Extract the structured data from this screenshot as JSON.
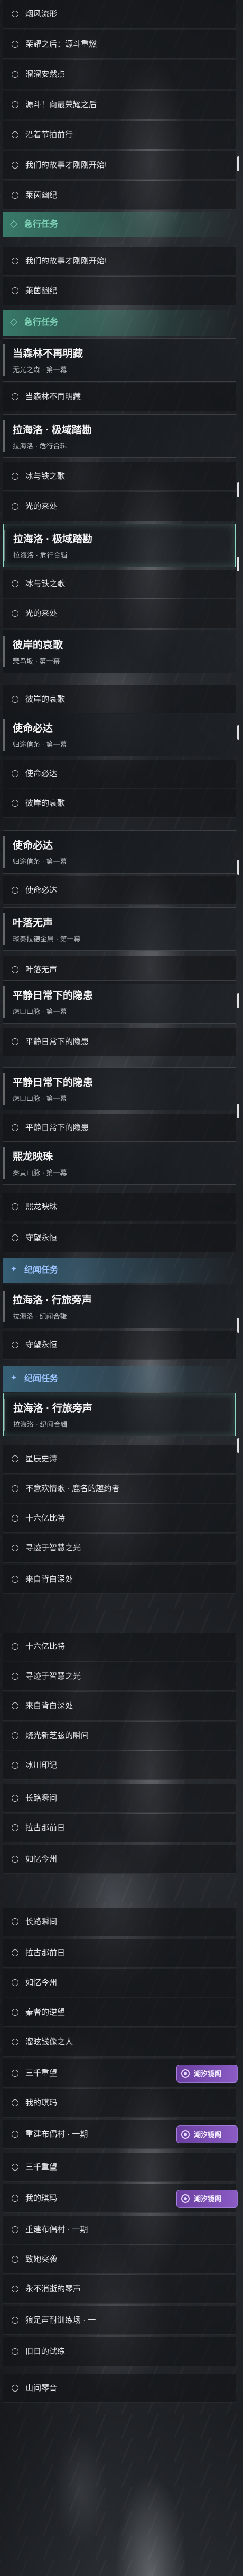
{
  "theme": {
    "rush_accent": "#7fd3b6",
    "rush_header_bg": "#3f8f7b",
    "tale_accent": "#9cc4ff",
    "tale_header_bg": "#3d6f8a",
    "badge_color": "#6b3fa0",
    "selected_border": "#8fd9c4"
  },
  "quest_log": {
    "rows": [
      {
        "kind": "item",
        "label": "烟风流形"
      },
      {
        "kind": "item",
        "label": "荣耀之后：源斗重燃"
      },
      {
        "kind": "item",
        "label": "溜溜安然点"
      },
      {
        "kind": "item",
        "label": "源斗！向最荣耀之后"
      },
      {
        "kind": "item",
        "label": "沿着节拍前行"
      },
      {
        "kind": "item",
        "label": "我们的故事才刚刚开始!"
      },
      {
        "kind": "item",
        "label": "莱茵幽纪"
      },
      {
        "kind": "header",
        "label": "急行任务",
        "icon": "diamond-icon",
        "style": "rush"
      },
      {
        "kind": "item",
        "label": "我们的故事才刚刚开始!"
      },
      {
        "kind": "item",
        "label": "莱茵幽纪"
      },
      {
        "kind": "header",
        "label": "急行任务",
        "icon": "diamond-icon",
        "style": "rush"
      },
      {
        "kind": "card",
        "title": "当森林不再明藏",
        "subtitle": "无光之森 · 第一幕"
      },
      {
        "kind": "item",
        "label": "当森林不再明藏"
      },
      {
        "kind": "card",
        "title": "拉海洛 · 极域踏勘",
        "subtitle": "拉海洛 · 危行合辑"
      },
      {
        "kind": "item",
        "label": "冰与铁之歌"
      },
      {
        "kind": "item",
        "label": "光的来处"
      },
      {
        "kind": "card",
        "title": "拉海洛 · 极域踏勘",
        "subtitle": "拉海洛 · 危行合辑",
        "selected": true
      },
      {
        "kind": "item",
        "label": "冰与铁之歌"
      },
      {
        "kind": "item",
        "label": "光的来处"
      },
      {
        "kind": "card",
        "title": "彼岸的哀歌",
        "subtitle": "悲鸟坂 · 第一幕"
      },
      {
        "kind": "item",
        "label": "彼岸的哀歌"
      },
      {
        "kind": "card",
        "title": "使命必达",
        "subtitle": "归途信条 · 第一幕"
      },
      {
        "kind": "item",
        "label": "使命必达"
      },
      {
        "kind": "item",
        "label": "彼岸的哀歌"
      },
      {
        "kind": "card",
        "title": "使命必达",
        "subtitle": "归途信条 · 第一幕"
      },
      {
        "kind": "item",
        "label": "使命必达"
      },
      {
        "kind": "card",
        "title": "叶落无声",
        "subtitle": "璨奏拉德金属 · 第一幕"
      },
      {
        "kind": "item",
        "label": "叶落无声"
      },
      {
        "kind": "card",
        "title": "平静日常下的隐患",
        "subtitle": "虎口山脉 · 第一幕"
      },
      {
        "kind": "item",
        "label": "平静日常下的隐患"
      },
      {
        "kind": "card",
        "title": "平静日常下的隐患",
        "subtitle": "虎口山脉 · 第一幕"
      },
      {
        "kind": "item",
        "label": "平静日常下的隐患"
      },
      {
        "kind": "card",
        "title": "熙龙映珠",
        "subtitle": "秦黄山脉 · 第一幕"
      },
      {
        "kind": "item",
        "label": "熙龙映珠"
      },
      {
        "kind": "item",
        "label": "守望永恒"
      },
      {
        "kind": "header",
        "label": "纪闻任务",
        "icon": "sparkle-icon",
        "style": "tale"
      },
      {
        "kind": "card",
        "title": "拉海洛 · 行旅旁声",
        "subtitle": "拉海洛 · 纪闻合辑"
      },
      {
        "kind": "item",
        "label": "守望永恒"
      },
      {
        "kind": "header",
        "label": "纪闻任务",
        "icon": "sparkle-icon",
        "style": "tale"
      },
      {
        "kind": "card",
        "title": "拉海洛 · 行旅旁声",
        "subtitle": "拉海洛 · 纪闻合辑",
        "selected": true
      },
      {
        "kind": "item",
        "label": "星辰史诗"
      },
      {
        "kind": "item",
        "label": "不意欢情歌 · 鹿名的趣约者"
      },
      {
        "kind": "item",
        "label": "十六亿比特"
      },
      {
        "kind": "item",
        "label": "寻迹于智慧之光"
      },
      {
        "kind": "item",
        "label": "来自背白深处"
      },
      {
        "kind": "item",
        "label": "十六亿比特"
      },
      {
        "kind": "item",
        "label": "寻迹于智慧之光"
      },
      {
        "kind": "item",
        "label": "来自背白深处"
      },
      {
        "kind": "item",
        "label": "烧光新芝弦的瞬间"
      },
      {
        "kind": "item",
        "label": "冰川印记"
      },
      {
        "kind": "item",
        "label": "长路瞬间"
      },
      {
        "kind": "item",
        "label": "拉古那前日"
      },
      {
        "kind": "item",
        "label": "如忆今州"
      },
      {
        "kind": "item",
        "label": "长路瞬间"
      },
      {
        "kind": "item",
        "label": "拉古那前日"
      },
      {
        "kind": "item",
        "label": "如忆今州"
      },
      {
        "kind": "item",
        "label": "秦者的逆望"
      },
      {
        "kind": "item",
        "label": "溜眩钱像之人"
      },
      {
        "kind": "item",
        "label": "三千重望",
        "badge": {
          "label": "潮汐镜阁",
          "icon": "tide-icon"
        }
      },
      {
        "kind": "item",
        "label": "我的琪玛"
      },
      {
        "kind": "item",
        "label": "重建布偶村 · 一期",
        "badge": {
          "label": "潮汐镜阁",
          "icon": "tide-icon"
        }
      },
      {
        "kind": "item",
        "label": "三千重望"
      },
      {
        "kind": "item",
        "label": "我的琪玛",
        "badge": {
          "label": "潮汐镜阁",
          "icon": "tide-icon"
        }
      },
      {
        "kind": "item",
        "label": "重建布偶村 · 一期"
      },
      {
        "kind": "item",
        "label": "致她突袭"
      },
      {
        "kind": "item",
        "label": "永不消逝的琴声"
      },
      {
        "kind": "item",
        "label": "狼足声耐训练场 · 一"
      },
      {
        "kind": "item",
        "label": "旧日的试练"
      },
      {
        "kind": "item",
        "label": "山间琴音"
      }
    ]
  }
}
